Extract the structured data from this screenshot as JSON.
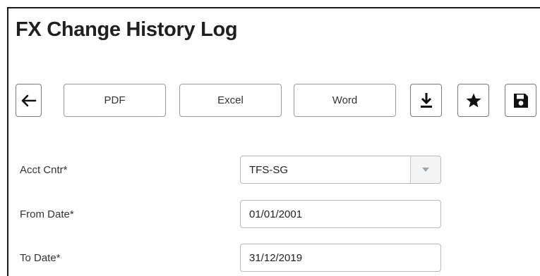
{
  "page": {
    "title": "FX Change History Log"
  },
  "toolbar": {
    "back_icon": "arrow-left-icon",
    "pdf_label": "PDF",
    "excel_label": "Excel",
    "word_label": "Word",
    "download_icon": "download-icon",
    "favorite_icon": "star-icon",
    "save_icon": "floppy-disk-icon"
  },
  "form": {
    "acct_cntr": {
      "label": "Acct Cntr*",
      "value": "TFS-SG",
      "dropdown_icon": "caret-down-icon"
    },
    "from_date": {
      "label": "From Date*",
      "value": "01/01/2001"
    },
    "to_date": {
      "label": "To Date*",
      "value": "31/12/2019"
    }
  },
  "colors": {
    "text": "#222222",
    "border": "#9a9a9a",
    "frame": "#1a1a1a",
    "select_arrow": "#9aa6b2"
  }
}
